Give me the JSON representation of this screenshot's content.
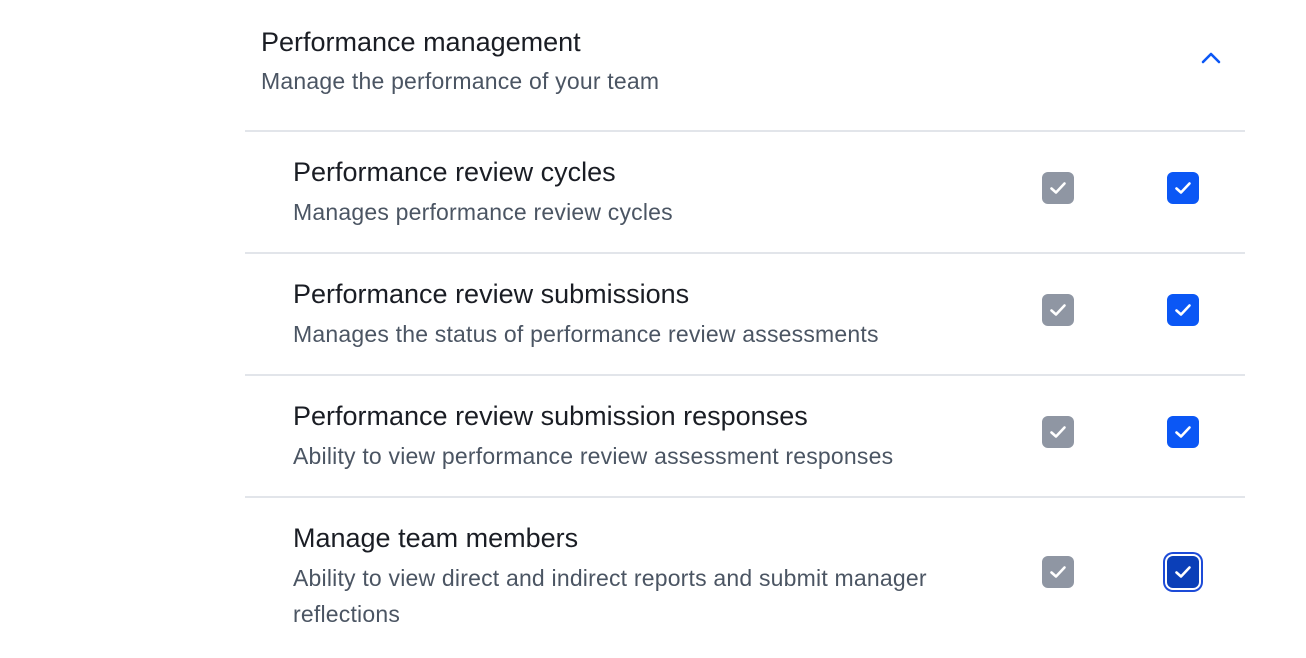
{
  "section": {
    "title": "Performance management",
    "subtitle": "Manage the performance of your team",
    "toggle_icon": "chevron-up-icon",
    "accent_color": "#0b57f5"
  },
  "rows": [
    {
      "title": "Performance review cycles",
      "description": "Manages performance review cycles",
      "checkbox_disabled_checked": true,
      "checkbox_checked": true
    },
    {
      "title": "Performance review submissions",
      "description": "Manages the status of performance review assessments",
      "checkbox_disabled_checked": true,
      "checkbox_checked": true
    },
    {
      "title": "Performance review submission responses",
      "description": "Ability to view performance review assessment responses",
      "checkbox_disabled_checked": true,
      "checkbox_checked": true
    },
    {
      "title": "Manage team members",
      "description": "Ability to view direct and indirect reports and submit manager reflections",
      "checkbox_disabled_checked": true,
      "checkbox_checked": true,
      "checkbox_focused": true
    }
  ],
  "colors": {
    "disabled_checkbox": "#8f96a3",
    "checked_checkbox": "#0b57f5",
    "divider": "#e2e5ea"
  }
}
